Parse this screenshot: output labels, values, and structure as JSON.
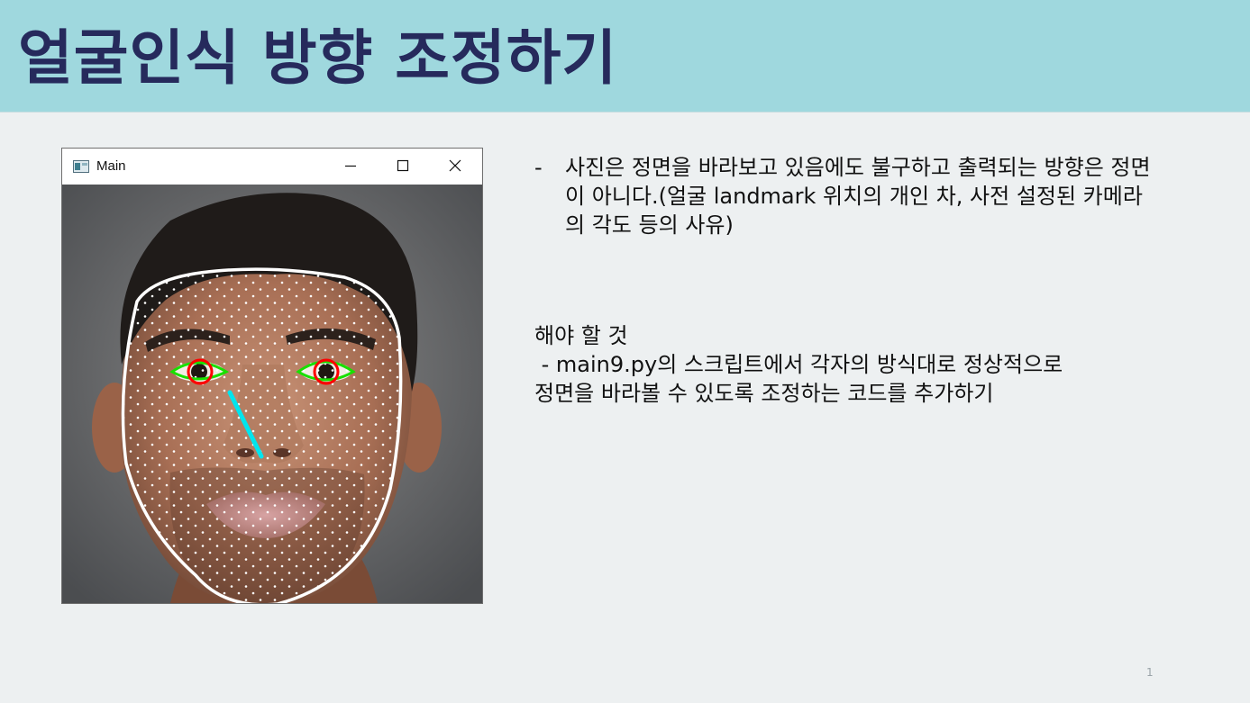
{
  "slide": {
    "title": "얼굴인식 방향 조정하기",
    "page_number": "1"
  },
  "window": {
    "title": "Main",
    "icon": "app-window-icon",
    "controls": [
      "minimize-icon",
      "maximize-icon",
      "close-icon"
    ]
  },
  "note": {
    "bullet": "-",
    "text": "사진은 정면을 바라보고 있음에도 불구하고 출력되는 방향은 정면이 아니다.(얼굴 landmark 위치의 개인 차, 사전 설정된 카메라의 각도 등의 사유)"
  },
  "todo": {
    "heading": "해야 할 것",
    "line1": " - main9.py의 스크립트에서 각자의 방식대로 정상적으로",
    "line2": "정면을 바라볼 수 있도록 조정하는 코드를 추가하기"
  },
  "colors": {
    "header_bg": "#9fd8de",
    "title_text": "#262a5c",
    "slide_bg": "#edf0f1",
    "face_outline": "#ffffff",
    "landmark_points": "#ffffff",
    "eye_outline": "#18e000",
    "iris_circle": "#ff0000",
    "gaze_line": "#00e5ee"
  }
}
